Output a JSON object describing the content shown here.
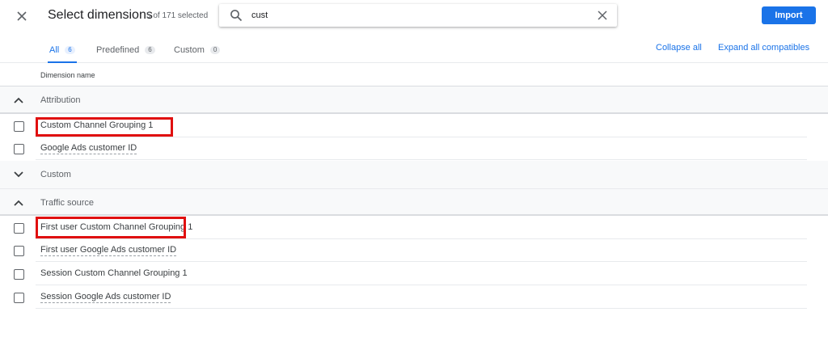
{
  "header": {
    "title": "Select dimensions",
    "subtitle": "5 of 171 selected",
    "import_label": "Import"
  },
  "search": {
    "value": "cust",
    "placeholder": ""
  },
  "tabs": [
    {
      "label": "All",
      "count": "6",
      "active": true
    },
    {
      "label": "Predefined",
      "count": "6",
      "active": false
    },
    {
      "label": "Custom",
      "count": "0",
      "active": false
    }
  ],
  "links": {
    "collapse_all": "Collapse all",
    "expand_all": "Expand all compatibles"
  },
  "column_header": "Dimension name",
  "groups": [
    {
      "label": "Attribution",
      "expanded": true,
      "items": [
        {
          "label": "Custom Channel Grouping 1",
          "highlighted": true
        },
        {
          "label": "Google Ads customer ID",
          "highlighted": false
        }
      ]
    },
    {
      "label": "Custom",
      "expanded": false,
      "items": []
    },
    {
      "label": "Traffic source",
      "expanded": true,
      "items": [
        {
          "label": "First user Custom Channel Grouping 1",
          "highlighted": true
        },
        {
          "label": "First user Google Ads customer ID",
          "highlighted": false
        },
        {
          "label": "Session Custom Channel Grouping 1",
          "highlighted": false
        },
        {
          "label": "Session Google Ads customer ID",
          "highlighted": false
        }
      ]
    }
  ],
  "colors": {
    "accent": "#1a73e8",
    "highlight": "#e01010"
  }
}
